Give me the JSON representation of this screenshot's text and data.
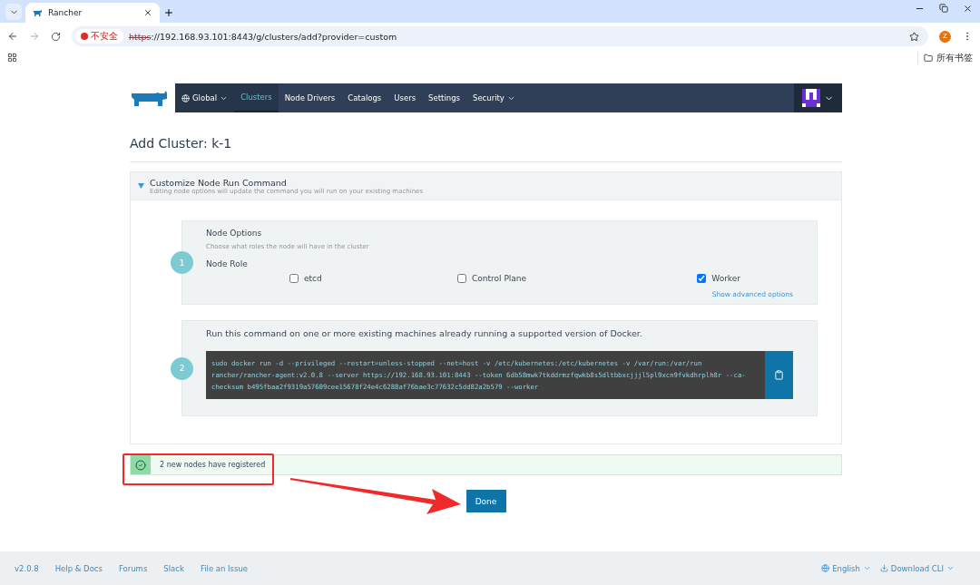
{
  "browser": {
    "tab_title": "Rancher",
    "not_secure_label": "不安全",
    "url_scheme": "https",
    "url_rest": "://192.168.93.101:8443/g/clusters/add?provider=custom",
    "profile_initial": "Z",
    "bookmarks_label": "所有书签"
  },
  "nav": {
    "items": [
      {
        "label": "Global",
        "kind": "scope",
        "selected": false
      },
      {
        "label": "Clusters",
        "kind": "link",
        "selected": true
      },
      {
        "label": "Node Drivers",
        "kind": "link",
        "selected": false
      },
      {
        "label": "Catalogs",
        "kind": "link",
        "selected": false
      },
      {
        "label": "Users",
        "kind": "link",
        "selected": false
      },
      {
        "label": "Settings",
        "kind": "link",
        "selected": false
      },
      {
        "label": "Security",
        "kind": "menu",
        "selected": false
      }
    ]
  },
  "page_title": "Add Cluster: k-1",
  "accordion": {
    "title": "Customize Node Run Command",
    "subtitle": "Editing node options will update the command you will run on your existing machines",
    "expanded": true
  },
  "steps": [
    {
      "number": "1",
      "kind": "options",
      "title": "Node Options",
      "hint": "Choose what roles the node will have in the cluster",
      "role_label": "Node Role",
      "roles": [
        {
          "label": "etcd",
          "checked": false
        },
        {
          "label": "Control Plane",
          "checked": false
        },
        {
          "label": "Worker",
          "checked": true
        }
      ],
      "advanced_link": "Show advanced options"
    },
    {
      "number": "2",
      "kind": "command",
      "instruction": "Run this command on one or more existing machines already running a supported version of Docker.",
      "command_lines": [
        "sudo docker run -d --privileged --restart=unless-stopped --net=host -v /etc/kubernetes:/etc/kubernetes -v /var/run:/var/run",
        "rancher/rancher-agent:v2.0.8 --server https://192.168.93.101:8443 --token 6db58mwk7tkddrmzfqwkb8s5dltbbxcjjjl5pl9xcn9fvkdhrplh8r --ca-",
        "checksum b495fbaa2f9319a57609cee15678f24e4c6288af76bae3c77632c5dd82a2b579 --worker"
      ]
    }
  ],
  "notice": "2 new nodes have registered",
  "done_button": "Done",
  "footer": {
    "links": [
      "v2.0.8",
      "Help & Docs",
      "Forums",
      "Slack",
      "File an Issue"
    ],
    "menus": [
      {
        "label": "English",
        "kind": "language"
      },
      {
        "label": "Download CLI",
        "kind": "download"
      }
    ]
  }
}
